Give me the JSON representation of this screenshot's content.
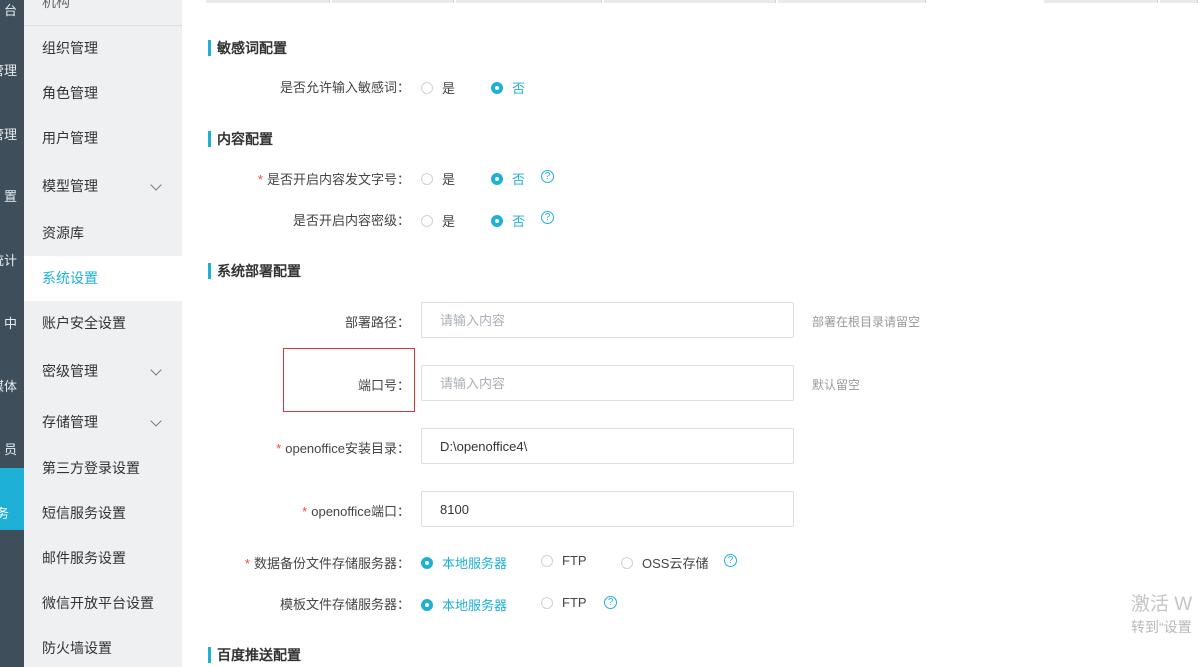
{
  "rail": {
    "items": [
      "台",
      "管理",
      "管理",
      "置",
      "统计",
      "中",
      "媒体",
      "员"
    ],
    "active_label": "务"
  },
  "sidebar": {
    "cut_item": "机构",
    "items": [
      {
        "label": "组织管理",
        "chevron": false,
        "active": false
      },
      {
        "label": "角色管理",
        "chevron": false,
        "active": false
      },
      {
        "label": "用户管理",
        "chevron": false,
        "active": false
      },
      {
        "label": "模型管理",
        "chevron": true,
        "active": false
      },
      {
        "label": "资源库",
        "chevron": false,
        "active": false
      },
      {
        "label": "系统设置",
        "chevron": false,
        "active": true
      },
      {
        "label": "账户安全设置",
        "chevron": false,
        "active": false
      },
      {
        "label": "密级管理",
        "chevron": true,
        "active": false
      },
      {
        "label": "存储管理",
        "chevron": true,
        "active": false
      },
      {
        "label": "第三方登录设置",
        "chevron": false,
        "active": false
      },
      {
        "label": "短信服务设置",
        "chevron": false,
        "active": false
      },
      {
        "label": "邮件服务设置",
        "chevron": false,
        "active": false
      },
      {
        "label": "微信开放平台设置",
        "chevron": false,
        "active": false
      },
      {
        "label": "防火墙设置",
        "chevron": false,
        "active": false
      }
    ]
  },
  "sections": {
    "sensitive": {
      "title": "敏感词配置",
      "allow_label": "是否允许输入敏感词：",
      "yes": "是",
      "no": "否"
    },
    "content": {
      "title": "内容配置",
      "doc_no_label": "是否开启内容发文字号：",
      "secret_label": "是否开启内容密级：",
      "yes": "是",
      "no": "否",
      "help": "?"
    },
    "deploy": {
      "title": "系统部署配置",
      "path_label": "部署路径：",
      "path_placeholder": "请输入内容",
      "path_hint": "部署在根目录请留空",
      "port_label": "端口号：",
      "port_placeholder": "请输入内容",
      "port_hint": "默认留空",
      "openoffice_dir_label": "openoffice安装目录：",
      "openoffice_dir_value": "D:\\openoffice4\\",
      "openoffice_port_label": "openoffice端口：",
      "openoffice_port_value": "8100",
      "backup_label": "数据备份文件存储服务器：",
      "template_label": "模板文件存储服务器：",
      "local": "本地服务器",
      "ftp": "FTP",
      "oss": "OSS云存储",
      "help": "?"
    },
    "baidu": {
      "title": "百度推送配置"
    }
  },
  "watermark": {
    "line1": "激活 W",
    "line2": "转到“设置"
  },
  "colors": {
    "accent": "#1fb0d8",
    "required": "#f04b3e",
    "rail": "#3e4e5b",
    "sidebar": "#eef0f2"
  }
}
